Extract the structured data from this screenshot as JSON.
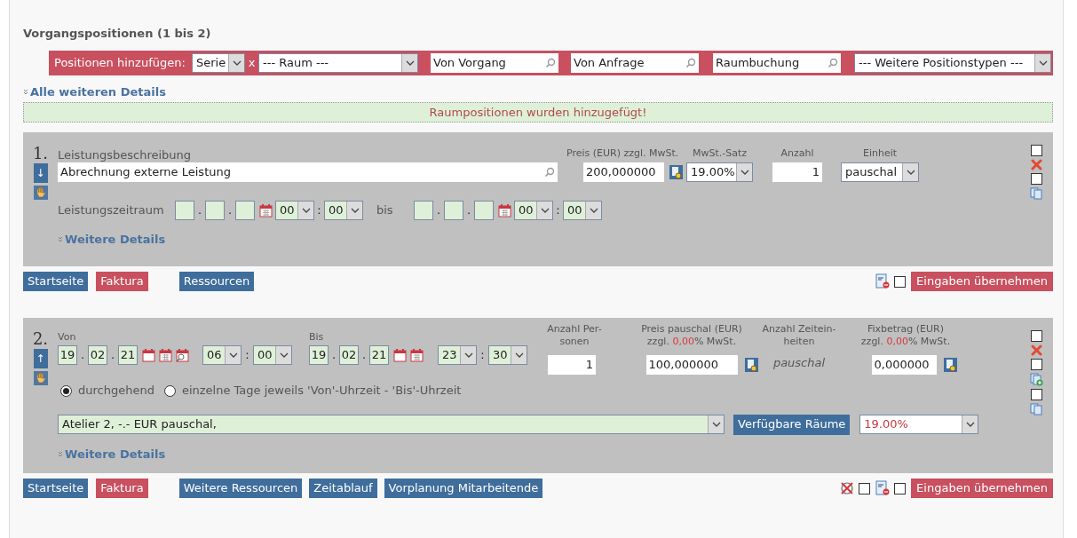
{
  "section_title": "Vorgangspositionen (1 bis 2)",
  "add_bar": {
    "label": "Positionen hinzufügen:",
    "series_select": "Serie",
    "separator": "x",
    "room_select": "--- Raum ---",
    "search_fields": [
      "Von Vorgang",
      "Von Anfrage",
      "Raumbuchung"
    ],
    "types_select": "--- Weitere Positionstypen ---"
  },
  "all_details_link": "Alle weiteren Details",
  "message": "Raumpositionen wurden hinzugefügt!",
  "date_separator": ".",
  "time_separator": ":",
  "positions": [
    {
      "kind": "service",
      "number": "1.",
      "move": "↓",
      "description": {
        "label": "Leistungsbeschreibung",
        "value": "Abrechnung externe Leistung"
      },
      "price": {
        "label": "Preis (EUR) zzgl. MwSt.",
        "value": "200,000000"
      },
      "vat": {
        "label": "MwSt.-Satz",
        "value": "19.00%"
      },
      "quantity": {
        "label": "Anzahl",
        "value": "1"
      },
      "unit": {
        "label": "Einheit",
        "value": "pauschal"
      },
      "period": {
        "label": "Leistungszeitraum",
        "from_time": [
          "00",
          "00"
        ],
        "to_label": "bis",
        "to_time": [
          "00",
          "00"
        ]
      },
      "details_link": "Weitere Details",
      "side_actions": [
        {
          "kind": "delete",
          "checked": false
        },
        {
          "kind": "copy",
          "checked": false
        }
      ],
      "footer_buttons": [
        {
          "label": "Startseite",
          "color": "#3f6d9c"
        },
        {
          "label": "Faktura",
          "color": "#c8505f"
        },
        {
          "label": "Ressourcen",
          "color": "#3f6d9c"
        }
      ],
      "footer_tools": [
        {
          "kind": "release",
          "checked": false
        }
      ],
      "submit": "Eingaben übernehmen"
    },
    {
      "kind": "room",
      "number": "2.",
      "move": "↑",
      "from": {
        "label": "Von",
        "date": [
          "19",
          "02",
          "21"
        ],
        "time": [
          "06",
          "00"
        ]
      },
      "to": {
        "label": "Bis",
        "date": [
          "19",
          "02",
          "21"
        ],
        "time": [
          "23",
          "30"
        ]
      },
      "persons": {
        "label": [
          "Anzahl Per-",
          "sonen"
        ],
        "value": "1"
      },
      "flat_price": {
        "label": "Preis pauschal (EUR)",
        "tax_prefix": "zzgl. ",
        "tax_rate": "0,00",
        "tax_suffix": "% MwSt.",
        "value": "100,000000"
      },
      "time_units": {
        "label": [
          "Anzahl Zeitein-",
          "heiten"
        ],
        "value": "pauschal"
      },
      "fixed_amount": {
        "label": "Fixbetrag (EUR)",
        "tax_prefix": "zzgl. ",
        "tax_rate": "0,00",
        "tax_suffix": "% MwSt.",
        "value": "0,000000"
      },
      "modes": [
        {
          "label": "durchgehend",
          "selected": true
        },
        {
          "label": "einzelne Tage jeweils 'Von'-Uhrzeit - 'Bis'-Uhrzeit",
          "selected": false
        }
      ],
      "room": "Atelier 2, -.- EUR pauschal,",
      "rooms_button": "Verfügbare Räume",
      "vat": "19.00%",
      "details_link": "Weitere Details",
      "side_actions": [
        {
          "kind": "delete",
          "checked": false
        },
        {
          "kind": "copy_add",
          "checked": false
        },
        {
          "kind": "copy",
          "checked": false
        }
      ],
      "footer_buttons": [
        {
          "label": "Startseite",
          "color": "#3f6d9c"
        },
        {
          "label": "Faktura",
          "color": "#c8505f"
        },
        {
          "label": "Weitere Ressourcen",
          "color": "#3f6d9c"
        },
        {
          "label": "Zeitablauf",
          "color": "#3f6d9c"
        },
        {
          "label": "Vorplanung Mitarbeitende",
          "color": "#3f6d9c"
        }
      ],
      "footer_tools": [
        {
          "kind": "cancel",
          "checked": false
        },
        {
          "kind": "release",
          "checked": false
        }
      ],
      "submit": "Eingaben übernehmen"
    }
  ]
}
